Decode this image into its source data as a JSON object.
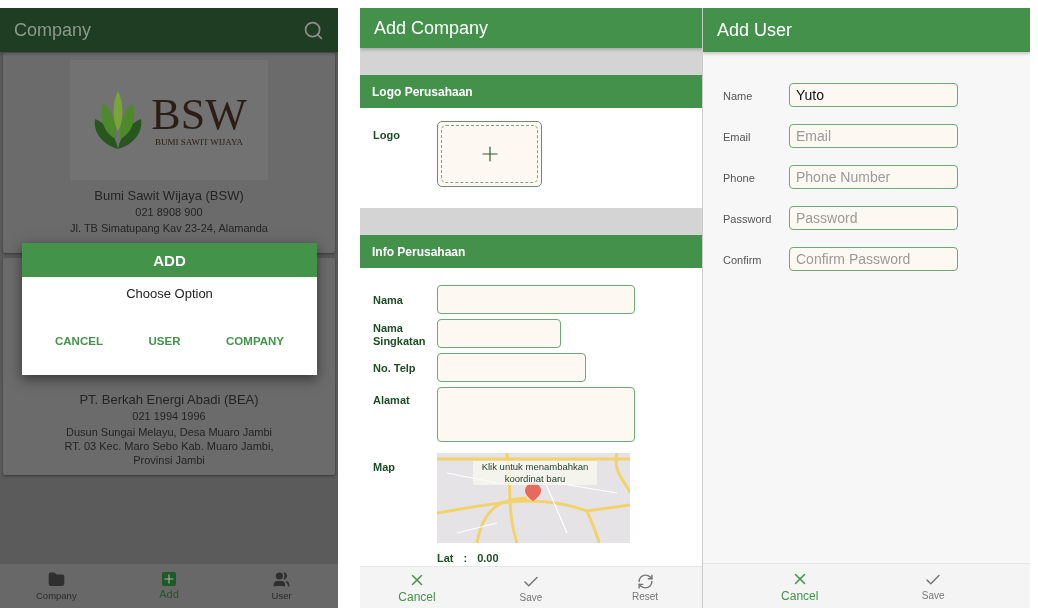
{
  "company_list": {
    "title": "Company",
    "cards": [
      {
        "logo": {
          "mark": "BSW",
          "tagline": "BUMI SAWIT WIJAYA"
        },
        "name": "Bumi Sawit Wijaya (BSW)",
        "phone": "021 8908 900",
        "address": "Jl. TB Simatupang Kav 23-24, Alamanda"
      },
      {
        "name": "PT. Berkah Energi Abadi (BEA)",
        "phone": "021 1994 1996",
        "address": "Dusun Sungai Melayu, Desa Muaro Jambi RT. 03 Kec. Maro Sebo Kab. Muaro Jambi, Provinsi Jambi"
      }
    ],
    "dialog": {
      "title": "ADD",
      "message": "Choose Option",
      "buttons": [
        "CANCEL",
        "USER",
        "COMPANY"
      ]
    },
    "nav": [
      {
        "label": "Company",
        "kind": "folder",
        "selected": false
      },
      {
        "label": "Add",
        "kind": "add",
        "selected": true
      },
      {
        "label": "User",
        "kind": "users",
        "selected": false
      }
    ]
  },
  "add_company": {
    "title": "Add Company",
    "sections": [
      {
        "title": "Logo Perusahaan",
        "rows": [
          {
            "kind": "logo",
            "label": "Logo"
          }
        ]
      },
      {
        "title": "Info Perusahaan",
        "rows": [
          {
            "kind": "input",
            "label": "Nama"
          },
          {
            "kind": "input",
            "label": "Nama Singkatan"
          },
          {
            "kind": "input",
            "label": "No. Telp"
          },
          {
            "kind": "textarea",
            "label": "Alamat"
          },
          {
            "kind": "map",
            "label": "Map",
            "hint": "Klik untuk menambahkan koordinat baru"
          }
        ]
      }
    ],
    "lat": {
      "label": "Lat",
      "separator": ":",
      "value": "0.00"
    },
    "actions": [
      {
        "label": "Cancel",
        "kind": "cancel"
      },
      {
        "label": "Save",
        "kind": "save"
      },
      {
        "label": "Reset",
        "kind": "reset"
      }
    ]
  },
  "add_user": {
    "title": "Add User",
    "fields": [
      {
        "label": "Name",
        "value": "Yuto"
      },
      {
        "label": "Email",
        "placeholder": "Email"
      },
      {
        "label": "Phone",
        "placeholder": "Phone Number"
      },
      {
        "label": "Password",
        "placeholder": "Password"
      },
      {
        "label": "Confirm",
        "placeholder": "Confirm Password"
      }
    ],
    "actions": [
      {
        "label": "Cancel",
        "kind": "cancel"
      },
      {
        "label": "Save",
        "kind": "save"
      }
    ]
  }
}
